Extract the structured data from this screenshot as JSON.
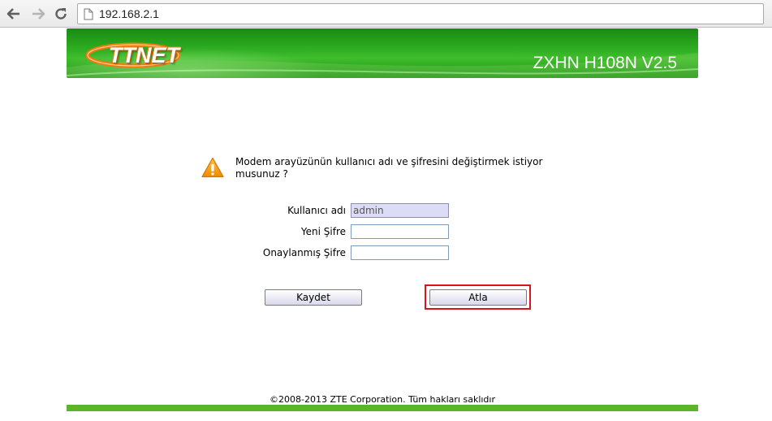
{
  "browser": {
    "url": "192.168.2.1",
    "icons": {
      "back": "back-arrow-icon",
      "forward": "forward-arrow-icon",
      "reload": "reload-icon",
      "page": "page-icon"
    }
  },
  "header": {
    "logo_text": "TTNET",
    "model": "ZXHN H108N V2.5",
    "colors": {
      "banner_green": "#2aa81f",
      "logo_orange": "#f07a10"
    }
  },
  "message": {
    "icon": "warning-icon",
    "text": "Modem arayüzünün kullanıcı adı ve şifresini değiştirmek istiyor musunuz ?"
  },
  "form": {
    "username_label": "Kullanıcı adı",
    "username_value": "admin",
    "new_password_label": "Yeni Şifre",
    "new_password_value": "",
    "confirm_password_label": "Onaylanmış Şifre",
    "confirm_password_value": ""
  },
  "buttons": {
    "save_label": "Kaydet",
    "skip_label": "Atla",
    "highlight_color": "#d9141c"
  },
  "footer": {
    "copyright": "©2008-2013 ZTE Corporation. Tüm hakları saklıdır",
    "bar_color": "#5cb42a"
  }
}
